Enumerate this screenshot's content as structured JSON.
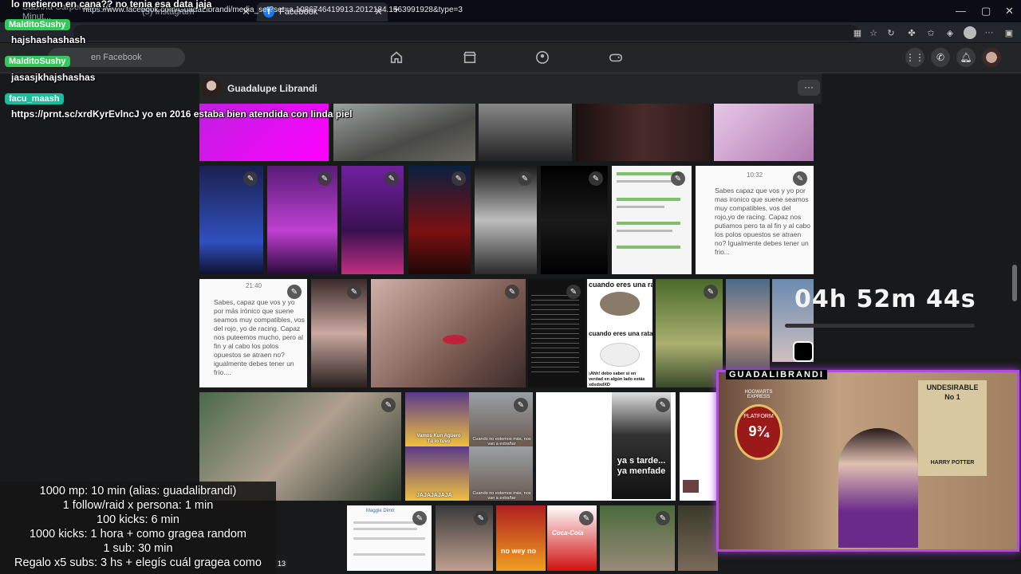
{
  "browser": {
    "tabs": [
      {
        "label": "Sabrina Carpenter - 15 Minut..."
      },
      {
        "label": "(5) Instagram"
      },
      {
        "label": "Facebook"
      }
    ],
    "new_tab": "+",
    "url": "https://www.facebook.com/GuadaLibrandi/media_set?set=a.1086746419913.2012184.1563991928&type=3",
    "window_controls": [
      "—",
      "▢",
      "✕"
    ]
  },
  "facebook": {
    "search_placeholder": "en Facebook",
    "album_owner": "Guadalupe Librandi",
    "more_label": "···"
  },
  "photos": {
    "chat_card_1": {
      "time": "10:32",
      "text": "Sabes capaz que vos y yo por mas ironico que suene seamos muy compatibles, vos del rojo,yo de racing. Capaz nos putiamos pero ta al fin y al cabo los polos opuestos se atraen no? Igualmente debes tener un frio..."
    },
    "chat_card_2": {
      "time": "21:40",
      "text": "Sabes, capaz que vos y yo por más irónico que suene seamos muy compatibles, vos del rojo, yo de racing. Capaz nos puteemos mucho, pero al fin y al cabo los polos opuestos se atraen no? igualmente debes tener un frío...."
    },
    "rata_meme": {
      "top": "cuando eres una rat",
      "middle": "cuando eres una rata blanc",
      "bottom": "¡Ahh! debo saber si en verdad en algún lado estás xdxdxdXD"
    },
    "simpsons_meme": {
      "caption1": "Vamos Kun Agüero Tú lo tuvo",
      "caption2": "Cuando no estemos más, nos van a extrañar",
      "caption3": "JAJAJAJAJA",
      "caption4": "Cuando no estemos más, nos van a extrañar"
    },
    "video_caption": "ya s tarde... ya menfade",
    "no_wey": "no wey no",
    "coca": "Coca-Cola",
    "post_author": "Maggie Dimti"
  },
  "stream": {
    "chat": [
      {
        "text": "lo metieron en cana?? no tenia esa data jaja"
      },
      {
        "user": "MalditoSushy",
        "text": "hajshashashash"
      },
      {
        "user": "MalditoSushy",
        "text": "jasasjkhajshashas"
      },
      {
        "user": "facu_maash",
        "text": "https://prnt.sc/xrdKyrEvlncJ yo en 2016 estaba bien atendida con linda piel"
      }
    ],
    "timer": "04h 52m 44s",
    "streamer_label": "GUADALIBRANDI",
    "goals": [
      "1000 mp: 10 min (alias: guadalibrandi)",
      "1 follow/raid x persona: 1 min",
      "100 kicks: 6 min",
      "1000 kicks: 1 hora + como gragea random",
      "1 sub: 30 min",
      "Regalo x5 subs: 3 hs + elegís cuál gragea como"
    ],
    "side_counter": "13",
    "cam_signs": {
      "hogwarts": "HOGWARTS EXPRESS",
      "platform": "PLATFORM",
      "number": "9¾",
      "undesirable": "UNDESIRABLE",
      "no1": "No 1",
      "harry": "HARRY POTTER"
    }
  }
}
